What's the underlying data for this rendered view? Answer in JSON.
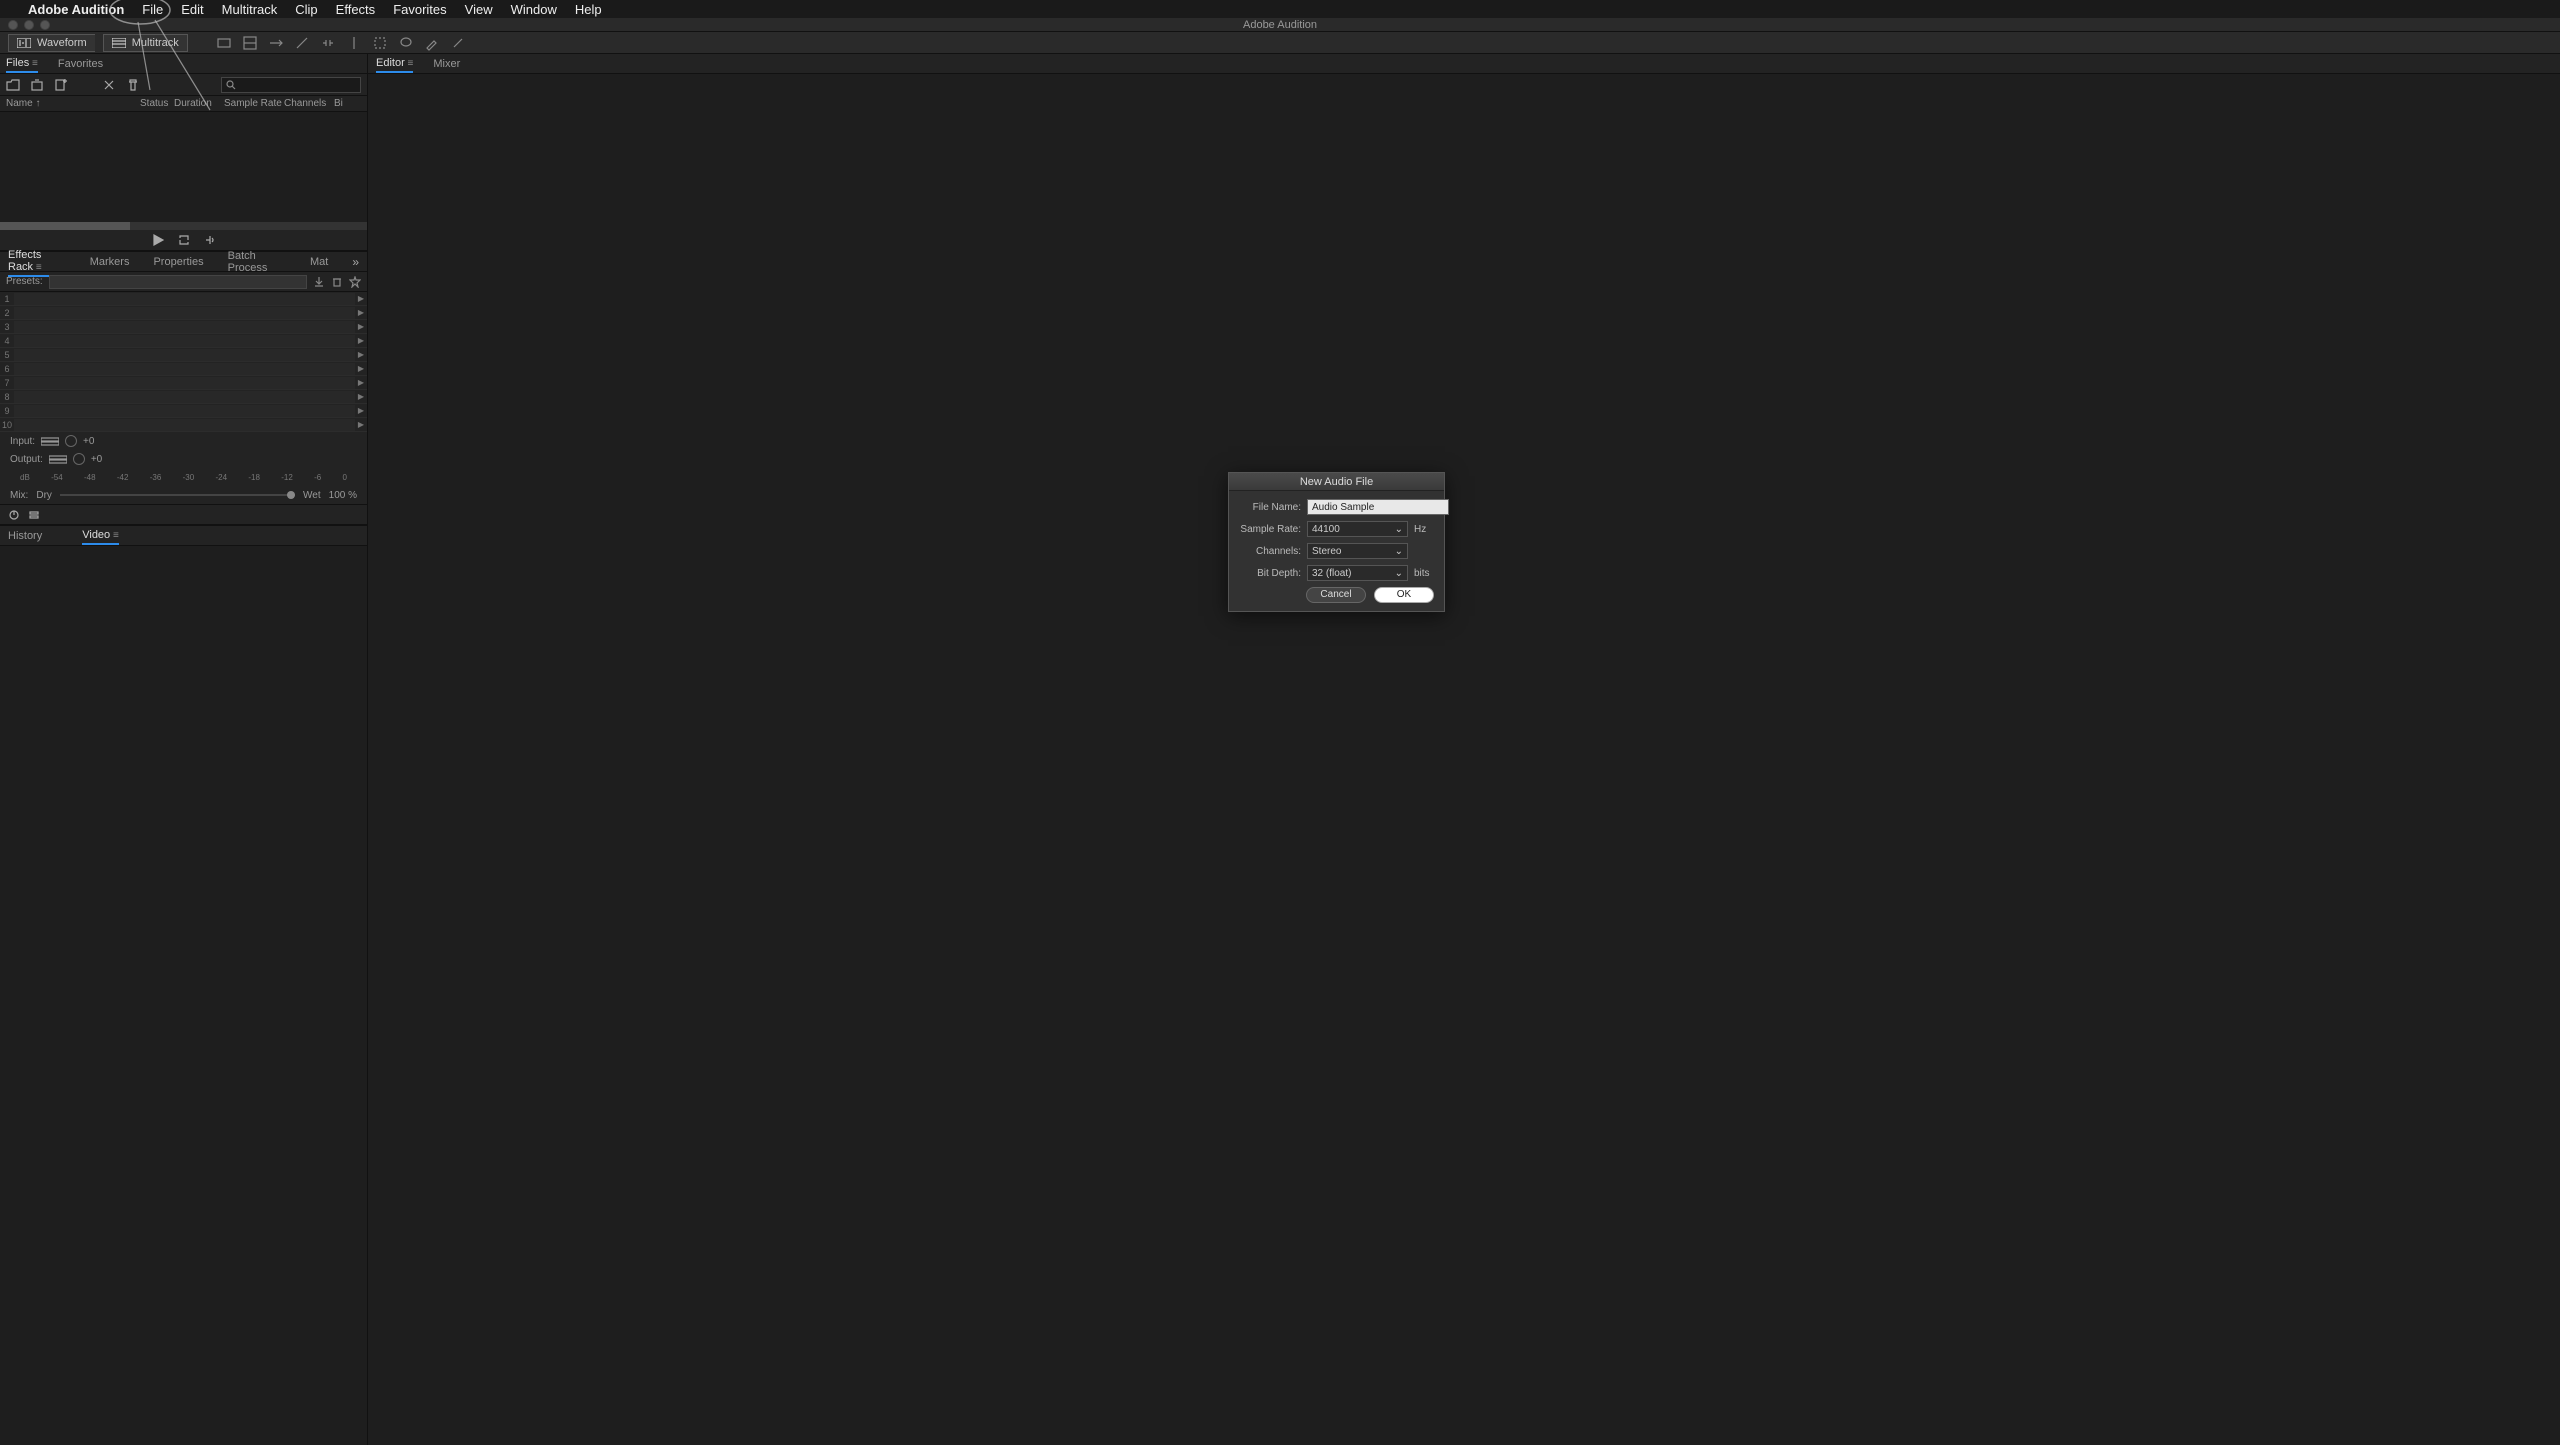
{
  "menubar": {
    "app_name": "Adobe Audition",
    "items": [
      "File",
      "Edit",
      "Multitrack",
      "Clip",
      "Effects",
      "Favorites",
      "View",
      "Window",
      "Help"
    ]
  },
  "window": {
    "title": "Adobe Audition"
  },
  "toolbar": {
    "waveform": "Waveform",
    "multitrack": "Multitrack"
  },
  "files_panel": {
    "tabs": [
      "Files",
      "Favorites"
    ],
    "active_tab": 0,
    "search_placeholder": "",
    "columns": [
      "Name ↑",
      "Status",
      "Duration",
      "Sample Rate",
      "Channels",
      "Bi"
    ]
  },
  "effects_panel": {
    "tabs": [
      "Effects Rack",
      "Markers",
      "Properties",
      "Batch Process",
      "Mat"
    ],
    "active_tab": 0,
    "presets_label": "Presets:",
    "slots": [
      1,
      2,
      3,
      4,
      5,
      6,
      7,
      8,
      9,
      10
    ],
    "input_label": "Input:",
    "input_value": "+0",
    "output_label": "Output:",
    "output_value": "+0",
    "db_marks": [
      "dB",
      "-54",
      "-48",
      "-42",
      "-36",
      "-30",
      "-24",
      "-18",
      "-12",
      "-6",
      "0"
    ],
    "mix_label": "Mix:",
    "mix_dry": "Dry",
    "mix_wet": "Wet",
    "mix_pct": "100 %"
  },
  "history_panel": {
    "tabs": [
      "History",
      "Video"
    ],
    "active_tab": 1
  },
  "editor_panel": {
    "tabs": [
      "Editor",
      "Mixer"
    ],
    "active_tab": 0
  },
  "dialog": {
    "title": "New Audio File",
    "filename_label": "File Name:",
    "filename_value": "Audio Sample",
    "samplerate_label": "Sample Rate:",
    "samplerate_value": "44100",
    "samplerate_unit": "Hz",
    "channels_label": "Channels:",
    "channels_value": "Stereo",
    "bitdepth_label": "Bit Depth:",
    "bitdepth_value": "32 (float)",
    "bitdepth_unit": "bits",
    "cancel": "Cancel",
    "ok": "OK"
  }
}
